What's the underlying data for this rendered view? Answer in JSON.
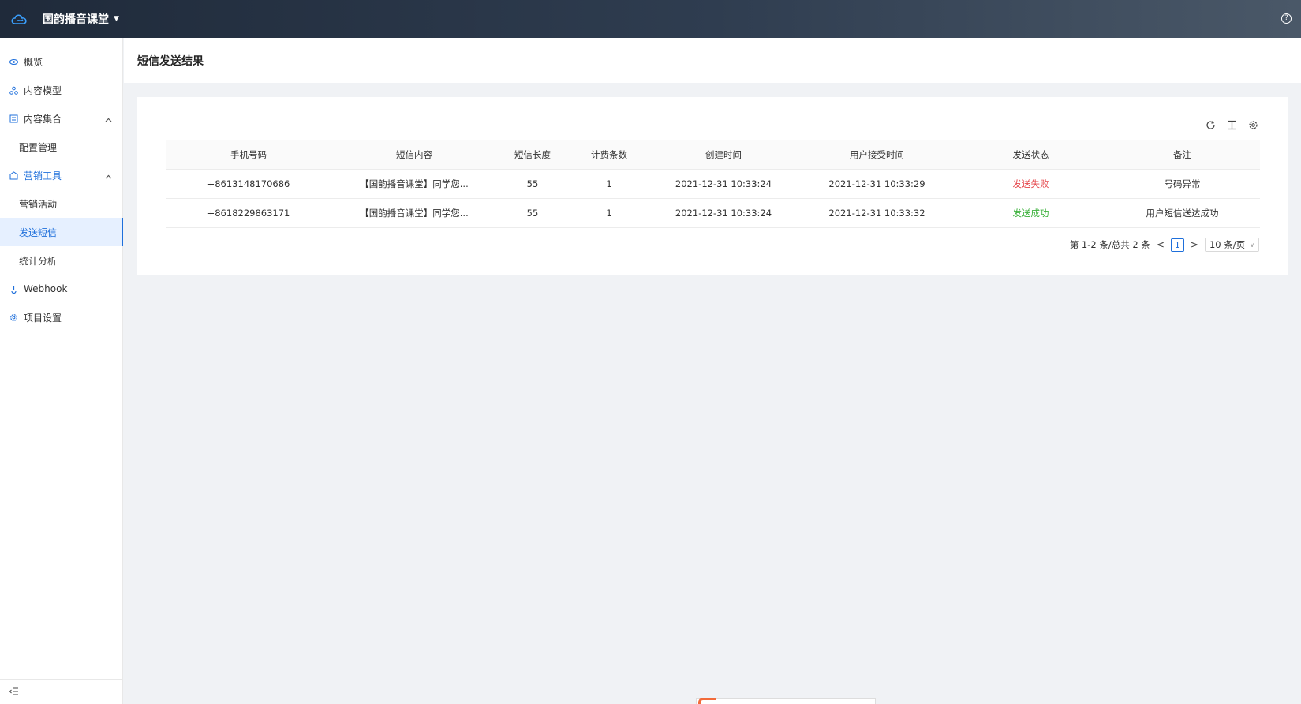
{
  "header": {
    "app_title": "国韵播音课堂",
    "help_label": "?"
  },
  "sidebar": {
    "items": [
      {
        "label": "概览"
      },
      {
        "label": "内容模型"
      },
      {
        "label": "内容集合"
      },
      {
        "label": "配置管理"
      },
      {
        "label": "营销工具"
      },
      {
        "label": "营销活动"
      },
      {
        "label": "发送短信"
      },
      {
        "label": "统计分析"
      },
      {
        "label": "Webhook"
      },
      {
        "label": "项目设置"
      }
    ],
    "active_item": "发送短信"
  },
  "page": {
    "title": "短信发送结果"
  },
  "table": {
    "columns": [
      "手机号码",
      "短信内容",
      "短信长度",
      "计费条数",
      "创建时间",
      "用户接受时间",
      "发送状态",
      "备注"
    ],
    "rows": [
      {
        "phone": "+8613148170686",
        "content": "【国韵播音课堂】同学您...",
        "length": "55",
        "count": "1",
        "created": "2021-12-31 10:33:24",
        "received": "2021-12-31 10:33:29",
        "status": "发送失败",
        "note": "号码异常"
      },
      {
        "phone": "+8618229863171",
        "content": "【国韵播音课堂】同学您...",
        "length": "55",
        "count": "1",
        "created": "2021-12-31 10:33:24",
        "received": "2021-12-31 10:33:32",
        "status": "发送成功",
        "note": "用户短信送达成功"
      }
    ]
  },
  "pagination": {
    "summary": "第 1-2 条/总共 2 条",
    "prev": "<",
    "next": ">",
    "current": "1",
    "page_size": "10 条/页"
  },
  "colors": {
    "accent": "#1e6fdb",
    "fail": "#e5484d",
    "success": "#3db23d"
  }
}
